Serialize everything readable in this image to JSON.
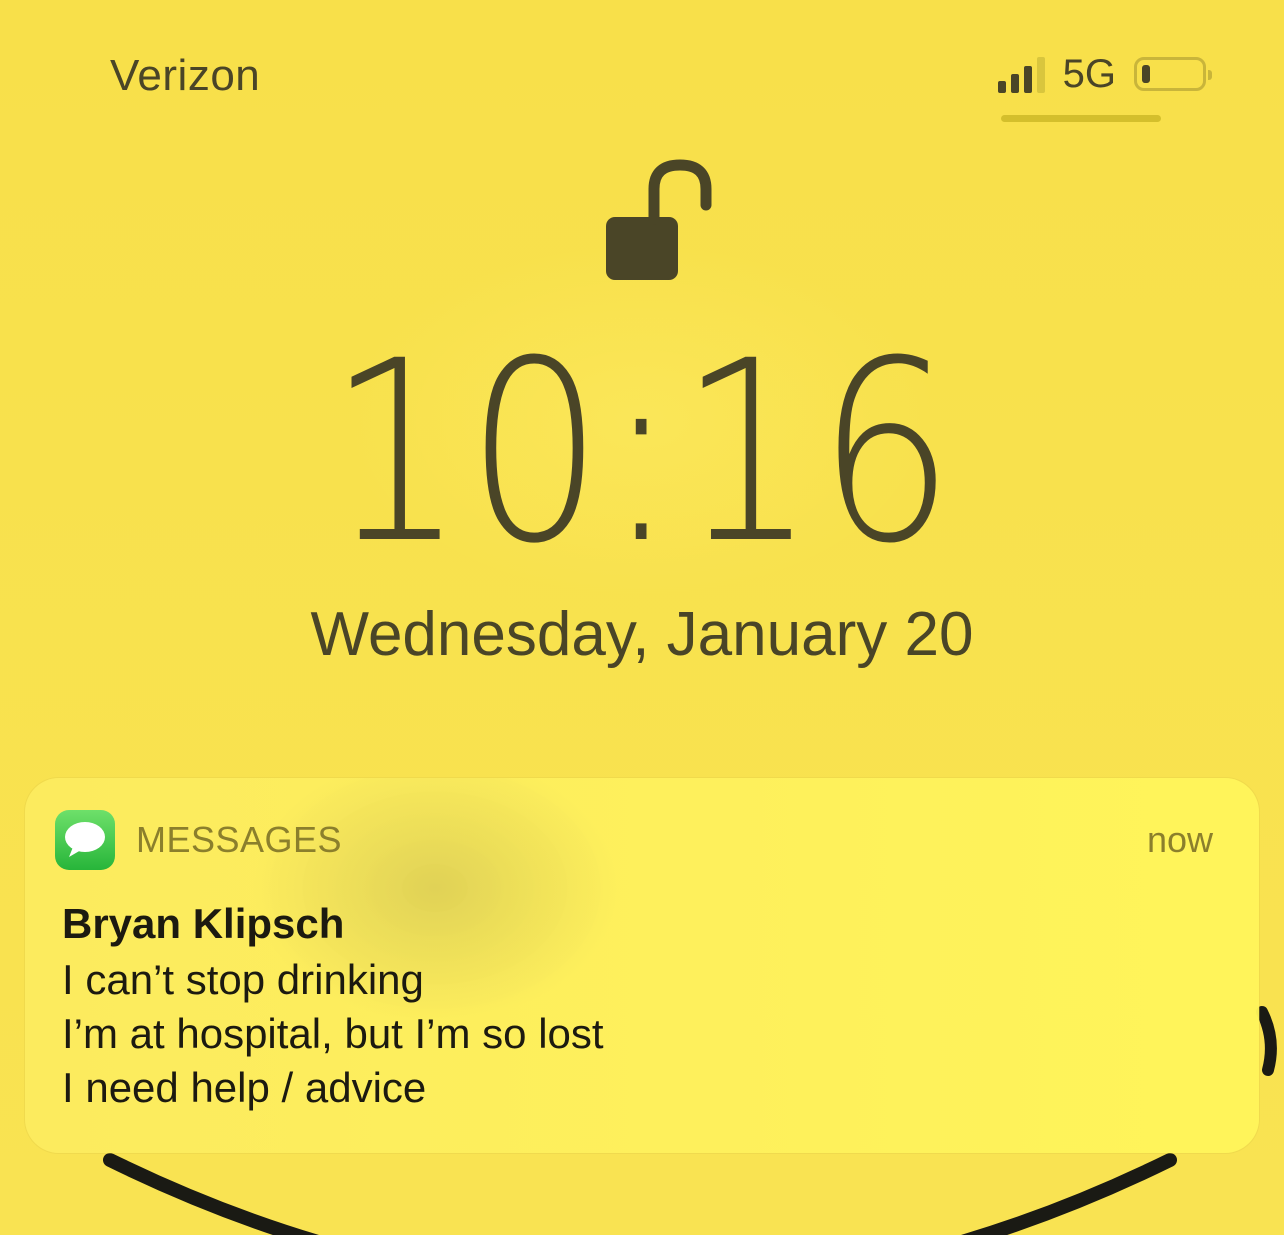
{
  "status_bar": {
    "carrier": "Verizon",
    "network": "5G",
    "signal_bars": 4,
    "signal_bars_active": 3,
    "battery_level": 0.15
  },
  "lock_screen": {
    "lock_icon": "unlocked-padlock-icon",
    "time": "10:16",
    "date": "Wednesday, January 20"
  },
  "notification": {
    "app_icon": "messages-icon",
    "app_name": "MESSAGES",
    "time_ago": "now",
    "sender": "Bryan Klipsch",
    "lines": [
      "I can’t stop drinking",
      "I’m at hospital, but I’m so lost",
      "I need help / advice"
    ]
  },
  "colors": {
    "background": "#f9e24e",
    "text": "#4a4527",
    "notification_text": "#1c1a10",
    "app_name": "#8b7f2c",
    "messages_green": "#34c759"
  }
}
